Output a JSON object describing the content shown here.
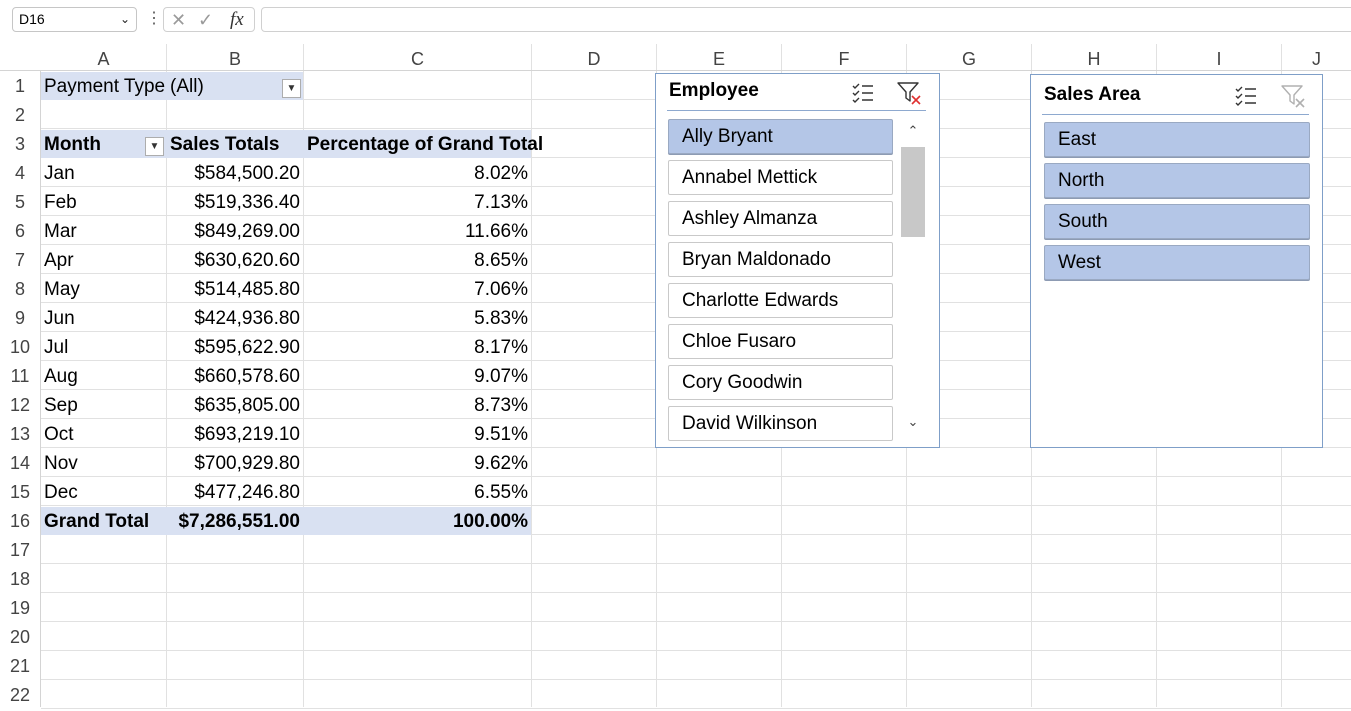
{
  "formula_bar": {
    "name_box": "D16",
    "dots": "⋮",
    "cancel_glyph": "✕",
    "enter_glyph": "✓",
    "fx_glyph": "fx",
    "formula": ""
  },
  "columns": [
    "A",
    "B",
    "C",
    "D",
    "E",
    "F",
    "G",
    "H",
    "I",
    "J"
  ],
  "rows": [
    "1",
    "2",
    "3",
    "4",
    "5",
    "6",
    "7",
    "8",
    "9",
    "10",
    "11",
    "12",
    "13",
    "14",
    "15",
    "16",
    "17",
    "18",
    "19",
    "20",
    "21",
    "22"
  ],
  "pivot": {
    "filter_label": "Payment Type",
    "filter_value": "(All)",
    "headers": {
      "month": "Month",
      "sales": "Sales Totals",
      "pct": "Percentage of Grand Total"
    },
    "rows": [
      {
        "month": "Jan",
        "sales": "$584,500.20",
        "pct": "8.02%"
      },
      {
        "month": "Feb",
        "sales": "$519,336.40",
        "pct": "7.13%"
      },
      {
        "month": "Mar",
        "sales": "$849,269.00",
        "pct": "11.66%"
      },
      {
        "month": "Apr",
        "sales": "$630,620.60",
        "pct": "8.65%"
      },
      {
        "month": "May",
        "sales": "$514,485.80",
        "pct": "7.06%"
      },
      {
        "month": "Jun",
        "sales": "$424,936.80",
        "pct": "5.83%"
      },
      {
        "month": "Jul",
        "sales": "$595,622.90",
        "pct": "8.17%"
      },
      {
        "month": "Aug",
        "sales": "$660,578.60",
        "pct": "9.07%"
      },
      {
        "month": "Sep",
        "sales": "$635,805.00",
        "pct": "8.73%"
      },
      {
        "month": "Oct",
        "sales": "$693,219.10",
        "pct": "9.51%"
      },
      {
        "month": "Nov",
        "sales": "$700,929.80",
        "pct": "9.62%"
      },
      {
        "month": "Dec",
        "sales": "$477,246.80",
        "pct": "6.55%"
      }
    ],
    "grand_total": {
      "label": "Grand Total",
      "sales": "$7,286,551.00",
      "pct": "100.00%"
    }
  },
  "employee_slicer": {
    "title": "Employee",
    "items": [
      {
        "label": "Ally Bryant",
        "selected": true
      },
      {
        "label": "Annabel Mettick",
        "selected": false
      },
      {
        "label": "Ashley Almanza",
        "selected": false
      },
      {
        "label": "Bryan Maldonado",
        "selected": false
      },
      {
        "label": "Charlotte Edwards",
        "selected": false
      },
      {
        "label": "Chloe Fusaro",
        "selected": false
      },
      {
        "label": "Cory Goodwin",
        "selected": false
      },
      {
        "label": "David Wilkinson",
        "selected": false
      }
    ],
    "multiselect_icon": "multi-select-icon",
    "clear_filter_icon": "clear-filter-icon",
    "clear_filter_active": true
  },
  "sales_area_slicer": {
    "title": "Sales Area",
    "items": [
      {
        "label": "East",
        "selected": true
      },
      {
        "label": "North",
        "selected": true
      },
      {
        "label": "South",
        "selected": true
      },
      {
        "label": "West",
        "selected": true
      }
    ],
    "multiselect_icon": "multi-select-icon",
    "clear_filter_icon": "clear-filter-icon",
    "clear_filter_active": false
  },
  "colors": {
    "pivot_band": "#d9e1f2",
    "slicer_selected": "#b4c6e7",
    "slicer_border": "#7f9fc8",
    "clear_filter_x": "#e03030"
  }
}
